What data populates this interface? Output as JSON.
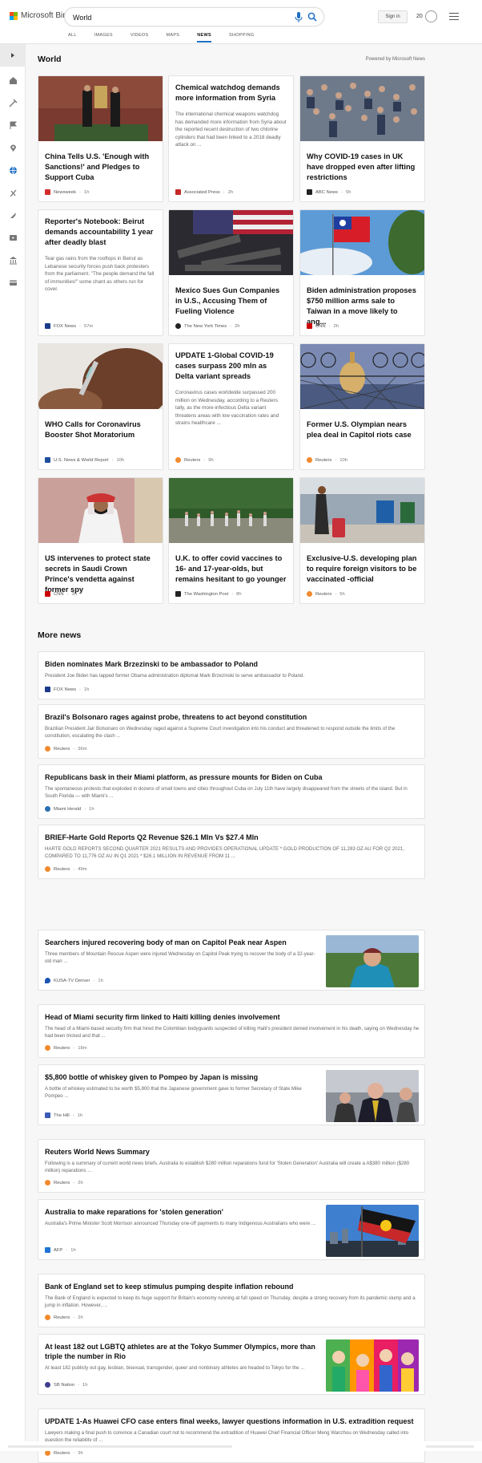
{
  "app": {
    "brand": "Microsoft Bing",
    "search_query": "World",
    "signin_label": "Sign in",
    "rewards_count": "20",
    "tabs": [
      "ALL",
      "IMAGES",
      "VIDEOS",
      "MAPS",
      "NEWS",
      "SHOPPING"
    ],
    "active_tab": "NEWS",
    "accent_color": "#1f6fc5"
  },
  "section": {
    "title": "World",
    "powered_by": "Powered by Microsoft News"
  },
  "cards": [
    {
      "title": "China Tells U.S. 'Enough with Sanctions!' and Pledges to Support Cuba",
      "summary": "",
      "source": "Newsweek",
      "time": "1h",
      "source_color": "#d32c2c",
      "icon": "newsweek-icon",
      "has_image": true
    },
    {
      "title": "Chemical watchdog demands more information from Syria",
      "summary": "The international chemical weapons watchdog has demanded more information from Syria about the reported recent destruction of two chlorine cylinders that had been linked to a 2018 deadly attack on ...",
      "source": "Associated Press",
      "time": "2h",
      "source_color": "#c62828",
      "icon": "ap-icon",
      "has_image": false
    },
    {
      "title": "Why COVID-19 cases in UK have dropped even after lifting restrictions",
      "summary": "",
      "source": "ABC News",
      "time": "5h",
      "source_color": "#222222",
      "icon": "abc-icon",
      "has_image": true
    },
    {
      "title": "Reporter's Notebook: Beirut demands accountability 1 year after deadly blast",
      "summary": "Tear gas rains from the rooftops in Beirut as Lebanese security forces push back protesters from the parliament. \"The people demand the fall of immunities!\" some chant as others run for cover.",
      "source": "FOX News",
      "time": "57m",
      "source_color": "#1b3a8a",
      "icon": "fox-icon",
      "has_image": false
    },
    {
      "title": "Mexico Sues Gun Companies in U.S., Accusing Them of Fueling Violence",
      "summary": "",
      "source": "The New York Times",
      "time": "2h",
      "source_color": "#222222",
      "icon": "nyt-icon",
      "has_image": true
    },
    {
      "title": "Biden administration proposes $750 million arms sale to Taiwan in a move likely to ang...",
      "summary": "",
      "source": "CNN",
      "time": "2h",
      "source_color": "#cc0000",
      "icon": "cnn-icon",
      "has_image": true
    },
    {
      "title": "WHO Calls for Coronavirus Booster Shot Moratorium",
      "summary": "",
      "source": "U.S. News & World Report",
      "time": "10h",
      "source_color": "#1f4e9c",
      "icon": "usnews-icon",
      "has_image": true
    },
    {
      "title": "UPDATE 1-Global COVID-19 cases surpass 200 mln as Delta variant spreads",
      "summary": "Coronavirus cases worldwide surpassed 200 million on Wednesday, according to a Reuters tally, as the more-infectious Delta variant threatens areas with low vaccination rates and strains healthcare ...",
      "source": "Reuters",
      "time": "9h",
      "source_color": "#f28a2e",
      "icon": "reuters-icon",
      "has_image": false
    },
    {
      "title": "Former U.S. Olympian nears plea deal in Capitol riots case",
      "summary": "",
      "source": "Reuters",
      "time": "10h",
      "source_color": "#f28a2e",
      "icon": "reuters-icon",
      "has_image": true
    },
    {
      "title": "US intervenes to protect state secrets in Saudi Crown Prince's vendetta against former spy",
      "summary": "",
      "source": "CNN",
      "time": "3h",
      "source_color": "#cc0000",
      "icon": "cnn-icon",
      "has_image": true
    },
    {
      "title": "U.K. to offer covid vaccines to 16- and 17-year-olds, but remains hesitant to go younger",
      "summary": "",
      "source": "The Washington Post",
      "time": "8h",
      "source_color": "#222222",
      "icon": "wapo-icon",
      "has_image": true
    },
    {
      "title": "Exclusive-U.S. developing plan to require foreign visitors to be vaccinated -official",
      "summary": "",
      "source": "Reuters",
      "time": "5h",
      "source_color": "#f28a2e",
      "icon": "reuters-icon",
      "has_image": true
    }
  ],
  "more_news": {
    "title": "More news",
    "items": [
      {
        "title": "Biden nominates Mark Brzezinski to be ambassador to Poland",
        "summary": "President Joe Biden has tapped former Obama administration diplomat Mark Brzezinski to serve ambassador to Poland.",
        "source": "FOX News",
        "time": "1h",
        "source_color": "#1b3a8a",
        "has_thumb": false
      },
      {
        "title": "Brazil's Bolsonaro rages against probe, threatens to act beyond constitution",
        "summary": "Brazilian President Jair Bolsonaro on Wednesday raged against a Supreme Court investigation into his conduct and threatened to respond outside the limits of the constitution, escalating the clash ...",
        "source": "Reuters",
        "time": "36m",
        "source_color": "#f28a2e",
        "has_thumb": false
      },
      {
        "title": "Republicans bask in their Miami platform, as pressure mounts for Biden on Cuba",
        "summary": "The spontaneous protests that exploded in dozens of small towns and cities throughout Cuba on July 11th have largely disappeared from the streets of the island. But in South Florida — with Miami's ...",
        "source": "Miami Herald",
        "time": "1h",
        "source_color": "#2a6fb0",
        "has_thumb": false
      },
      {
        "title": "BRIEF-Harte Gold Reports Q2 Revenue $26.1 Mln Vs $27.4 Mln",
        "summary": "HARTE GOLD REPORTS SECOND QUARTER 2021 RESULTS AND PROVIDES OPERATIONAL UPDATE * GOLD PRODUCTION OF 11,283 OZ AU FOR Q2 2021, COMPARED TO 11,776 OZ AU IN Q1 2021 * $26.1 MILLION IN REVENUE FROM 11 ...",
        "source": "Reuters",
        "time": "49m",
        "source_color": "#f28a2e",
        "has_thumb": false
      },
      {
        "title": "Searchers injured recovering body of man on Capitol Peak near Aspen",
        "summary": "Three members of Mountain Rescue Aspen were injured Wednesday on Capitol Peak trying to recover the body of a 32-year-old man ...",
        "source": "KUSA-TV Denver",
        "time": "1h",
        "source_color": "#1a55b4",
        "has_thumb": true
      },
      {
        "title": "Head of Miami security firm linked to Haiti killing denies involvement",
        "summary": "The head of a Miami-based security firm that hired the Colombian bodyguards suspected of killing Haiti's president denied involvement in his death, saying on Wednesday he had been tricked and that ...",
        "source": "Reuters",
        "time": "18m",
        "source_color": "#f28a2e",
        "has_thumb": false
      },
      {
        "title": "$5,800 bottle of whiskey given to Pompeo by Japan is missing",
        "summary": "A bottle of whiskey estimated to be worth $5,800 that the Japanese government gave to former Secretary of State Mike Pompeo ...",
        "source": "The Hill",
        "time": "1h",
        "source_color": "#3b5bb5",
        "has_thumb": true
      },
      {
        "title": "Reuters World News Summary",
        "summary": "Following is a summary of current world news briefs. Australia to establish $280 million reparations fund for 'Stolen Generation' Australia will create a A$380 million ($280 million) reparations ...",
        "source": "Reuters",
        "time": "2h",
        "source_color": "#f28a2e",
        "has_thumb": false
      },
      {
        "title": "Australia to make reparations for 'stolen generation'",
        "summary": "Australia's Prime Minister Scott Morrison announced Thursday one-off payments to many Indigenous Australians who were ...",
        "source": "AFP",
        "time": "1h",
        "source_color": "#1f74d6",
        "has_thumb": true
      },
      {
        "title": "Bank of England set to keep stimulus pumping despite inflation rebound",
        "summary": "The Bank of England is expected to keep its huge support for Britain's economy running at full speed on Thursday, despite a strong recovery from its pandemic slump and a jump in inflation. However, ...",
        "source": "Reuters",
        "time": "2h",
        "source_color": "#f28a2e",
        "has_thumb": false
      },
      {
        "title": "At least 182 out LGBTQ athletes are at the Tokyo Summer Olympics, more than triple the number in Rio",
        "summary": "At least 182 publicly out gay, lesbian, bisexual, transgender, queer and nonbinary athletes are headed to Tokyo for the ...",
        "source": "SB Nation",
        "time": "1h",
        "source_color": "#3e3e8f",
        "has_thumb": true
      },
      {
        "title": "UPDATE 1-As Huawei CFO case enters final weeks, lawyer questions information in U.S. extradition request",
        "summary": "Lawyers making a final push to convince a Canadian court not to recommend the extradition of Huawei Chief Financial Officer Meng Wanzhou on Wednesday called into question the reliability of ...",
        "source": "Reuters",
        "time": "3h",
        "source_color": "#f28a2e",
        "has_thumb": false
      }
    ]
  }
}
